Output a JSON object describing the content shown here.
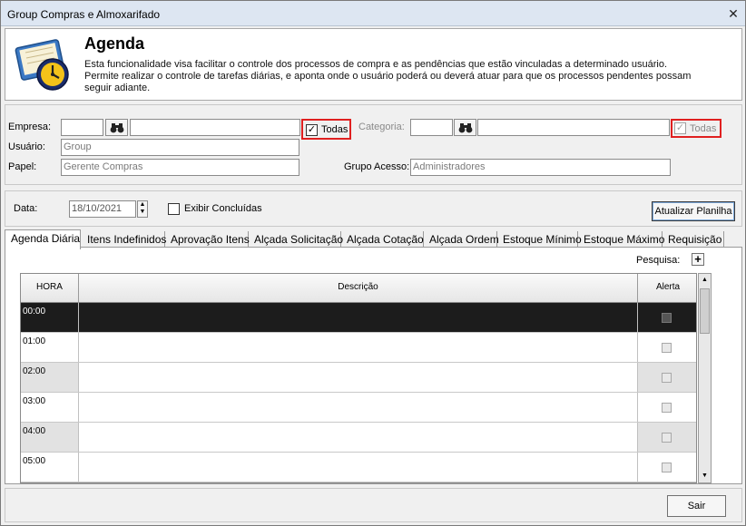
{
  "window": {
    "title": "Group Compras e Almoxarifado",
    "close_glyph": "✕"
  },
  "header": {
    "title": "Agenda",
    "description_lines": [
      "Esta funcionalidade visa facilitar o controle dos processos de compra e as pendências que estão vinculadas a determinado usuário.",
      "Permite realizar o controle de tarefas diárias, e aponta onde o usuário poderá ou deverá atuar para que os processos pendentes possam",
      "seguir adiante."
    ],
    "icon": "agenda-book-clock-icon"
  },
  "filters": {
    "empresa_label": "Empresa:",
    "empresa_code": "",
    "empresa_name": "",
    "todas_empresa_label": "Todas",
    "todas_empresa_checked": true,
    "categoria_label": "Categoria:",
    "categoria_code": "",
    "categoria_name": "",
    "todas_categoria_label": "Todas",
    "todas_categoria_checked": true,
    "usuario_label": "Usuário:",
    "usuario_value": "Group",
    "papel_label": "Papel:",
    "papel_value": "Gerente Compras",
    "grupo_label": "Grupo Acesso:",
    "grupo_value": "Administradores",
    "search_icon": "binoculars-icon"
  },
  "datebar": {
    "data_label": "Data:",
    "date_value": "18/10/2021",
    "exibir_label": "Exibir Concluídas",
    "exibir_checked": false,
    "atualizar_label": "Atualizar Planilha"
  },
  "tabs": [
    {
      "label": "Agenda Diária"
    },
    {
      "label": "Itens Indefinidos"
    },
    {
      "label": "Aprovação Itens"
    },
    {
      "label": "Alçada Solicitação"
    },
    {
      "label": "Alçada Cotação"
    },
    {
      "label": "Alçada Ordem"
    },
    {
      "label": "Estoque Mínimo"
    },
    {
      "label": "Estoque Máximo"
    },
    {
      "label": "Requisição"
    }
  ],
  "pesquisa": {
    "label": "Pesquisa:",
    "add_glyph": "+"
  },
  "grid": {
    "columns": [
      "HORA",
      "Descrição",
      "Alerta"
    ],
    "rows": [
      {
        "hora": "00:00",
        "descricao": ""
      },
      {
        "hora": "01:00",
        "descricao": ""
      },
      {
        "hora": "02:00",
        "descricao": ""
      },
      {
        "hora": "03:00",
        "descricao": ""
      },
      {
        "hora": "04:00",
        "descricao": ""
      },
      {
        "hora": "05:00",
        "descricao": ""
      }
    ]
  },
  "footer": {
    "sair_label": "Sair"
  },
  "colors": {
    "highlight_red": "#e02020",
    "selected_row": "#1c1c1c",
    "titlebar": "#dde6f2"
  }
}
